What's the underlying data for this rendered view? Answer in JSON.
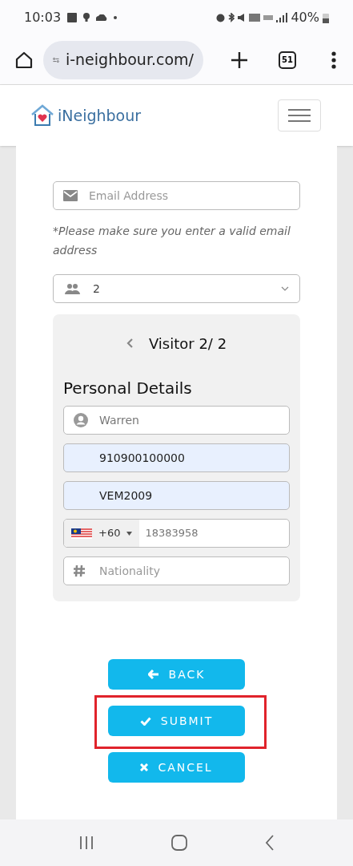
{
  "status_bar": {
    "time": "10:03",
    "battery": "40%"
  },
  "browser": {
    "url": "i-neighbour.com/",
    "tab_count": "51"
  },
  "header": {
    "logo": "iNeighbour"
  },
  "form": {
    "email": {
      "placeholder": "Email Address"
    },
    "hint": "*Please make sure you enter a valid email address",
    "visitor_count": {
      "value": "2"
    },
    "visitor_panel": {
      "title": "Visitor 2/ 2",
      "section": "Personal Details",
      "fields": [
        {
          "kind": "name",
          "value": "Warren",
          "autofilled": false
        },
        {
          "kind": "plain",
          "value": "910900100000",
          "autofilled": true
        },
        {
          "kind": "plain",
          "value": "VEM2009",
          "autofilled": true
        },
        {
          "kind": "phone",
          "code": "+60",
          "value": "18383958",
          "autofilled": false
        },
        {
          "kind": "nationality",
          "placeholder": "Nationality",
          "autofilled": false
        }
      ]
    }
  },
  "buttons": [
    {
      "kind": "back",
      "label": "BACK",
      "highlighted": false
    },
    {
      "kind": "submit",
      "label": "SUBMIT",
      "highlighted": true
    },
    {
      "kind": "cancel",
      "label": "CANCEL",
      "highlighted": false
    }
  ]
}
